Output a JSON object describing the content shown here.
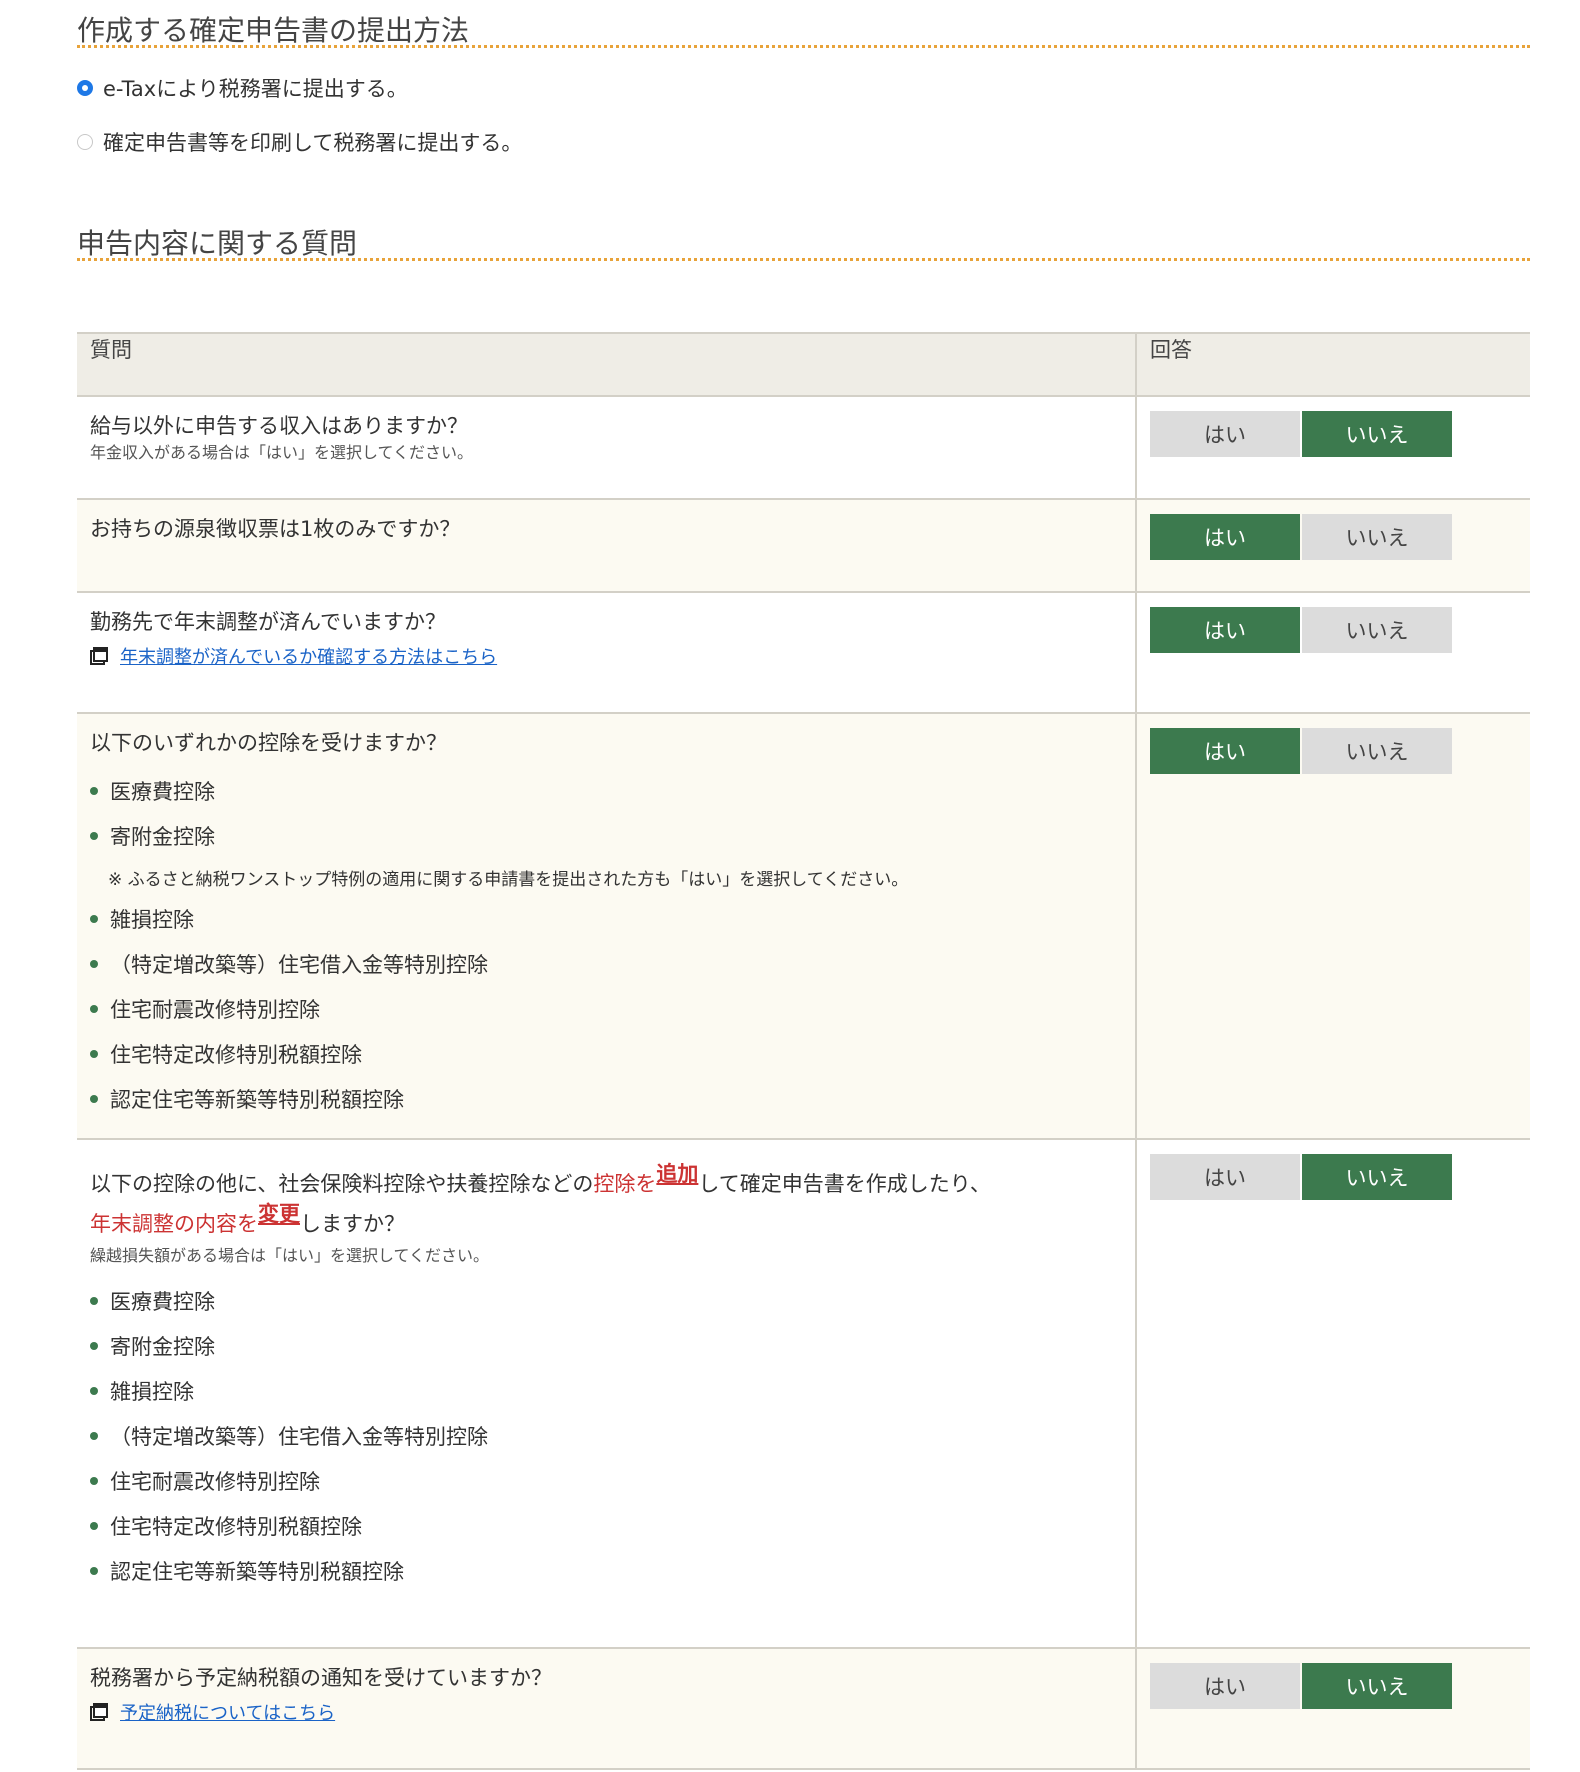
{
  "submission": {
    "title": "作成する確定申告書の提出方法",
    "options": [
      {
        "label": "e-Taxにより税務署に提出する。",
        "selected": true
      },
      {
        "label": "確定申告書等を印刷して税務署に提出する。",
        "selected": false
      }
    ]
  },
  "questions_section": {
    "title": "申告内容に関する質問",
    "headers": {
      "question": "質問",
      "answer": "回答"
    },
    "yes_label": "はい",
    "no_label": "いいえ",
    "rows": [
      {
        "question": "給与以外に申告する収入はありますか？",
        "note": "年金収入がある場合は「はい」を選択してください。",
        "answer": "no"
      },
      {
        "question": "お持ちの源泉徴収票は1枚のみですか？",
        "answer": "yes"
      },
      {
        "question": "勤務先で年末調整が済んでいますか？",
        "link": "年末調整が済んでいるか確認する方法はこちら",
        "answer": "yes"
      },
      {
        "question": "以下のいずれかの控除を受けますか？",
        "items": [
          "医療費控除",
          "寄附金控除"
        ],
        "sub_note": "※ ふるさと納税ワンストップ特例の適用に関する申請書を提出された方も「はい」を選択してください。",
        "items2": [
          "雑損控除",
          "（特定増改築等）住宅借入金等特別控除",
          "住宅耐震改修特別控除",
          "住宅特定改修特別税額控除",
          "認定住宅等新築等特別税額控除"
        ],
        "answer": "yes"
      },
      {
        "question_part1": "以下の控除の他に、社会保険料控除や扶養控除などの",
        "question_red1": "控除を",
        "question_red1_strong": "追加",
        "question_part2": "して確定申告書を作成したり、",
        "question_red2": "年末調整の内容を",
        "question_red2_strong": "変更",
        "question_part3": "しますか？",
        "note": "繰越損失額がある場合は「はい」を選択してください。",
        "items": [
          "医療費控除",
          "寄附金控除",
          "雑損控除",
          "（特定増改築等）住宅借入金等特別控除",
          "住宅耐震改修特別控除",
          "住宅特定改修特別税額控除",
          "認定住宅等新築等特別税額控除"
        ],
        "answer": "no"
      },
      {
        "question": "税務署から予定納税額の通知を受けていますか？",
        "link": "予定納税についてはこちら",
        "answer": "no"
      }
    ]
  },
  "colors": {
    "accent_green": "#3c7a4e",
    "dotted_orange": "#e8a33a",
    "link_blue": "#1a63c7",
    "alert_red": "#cc3333"
  }
}
